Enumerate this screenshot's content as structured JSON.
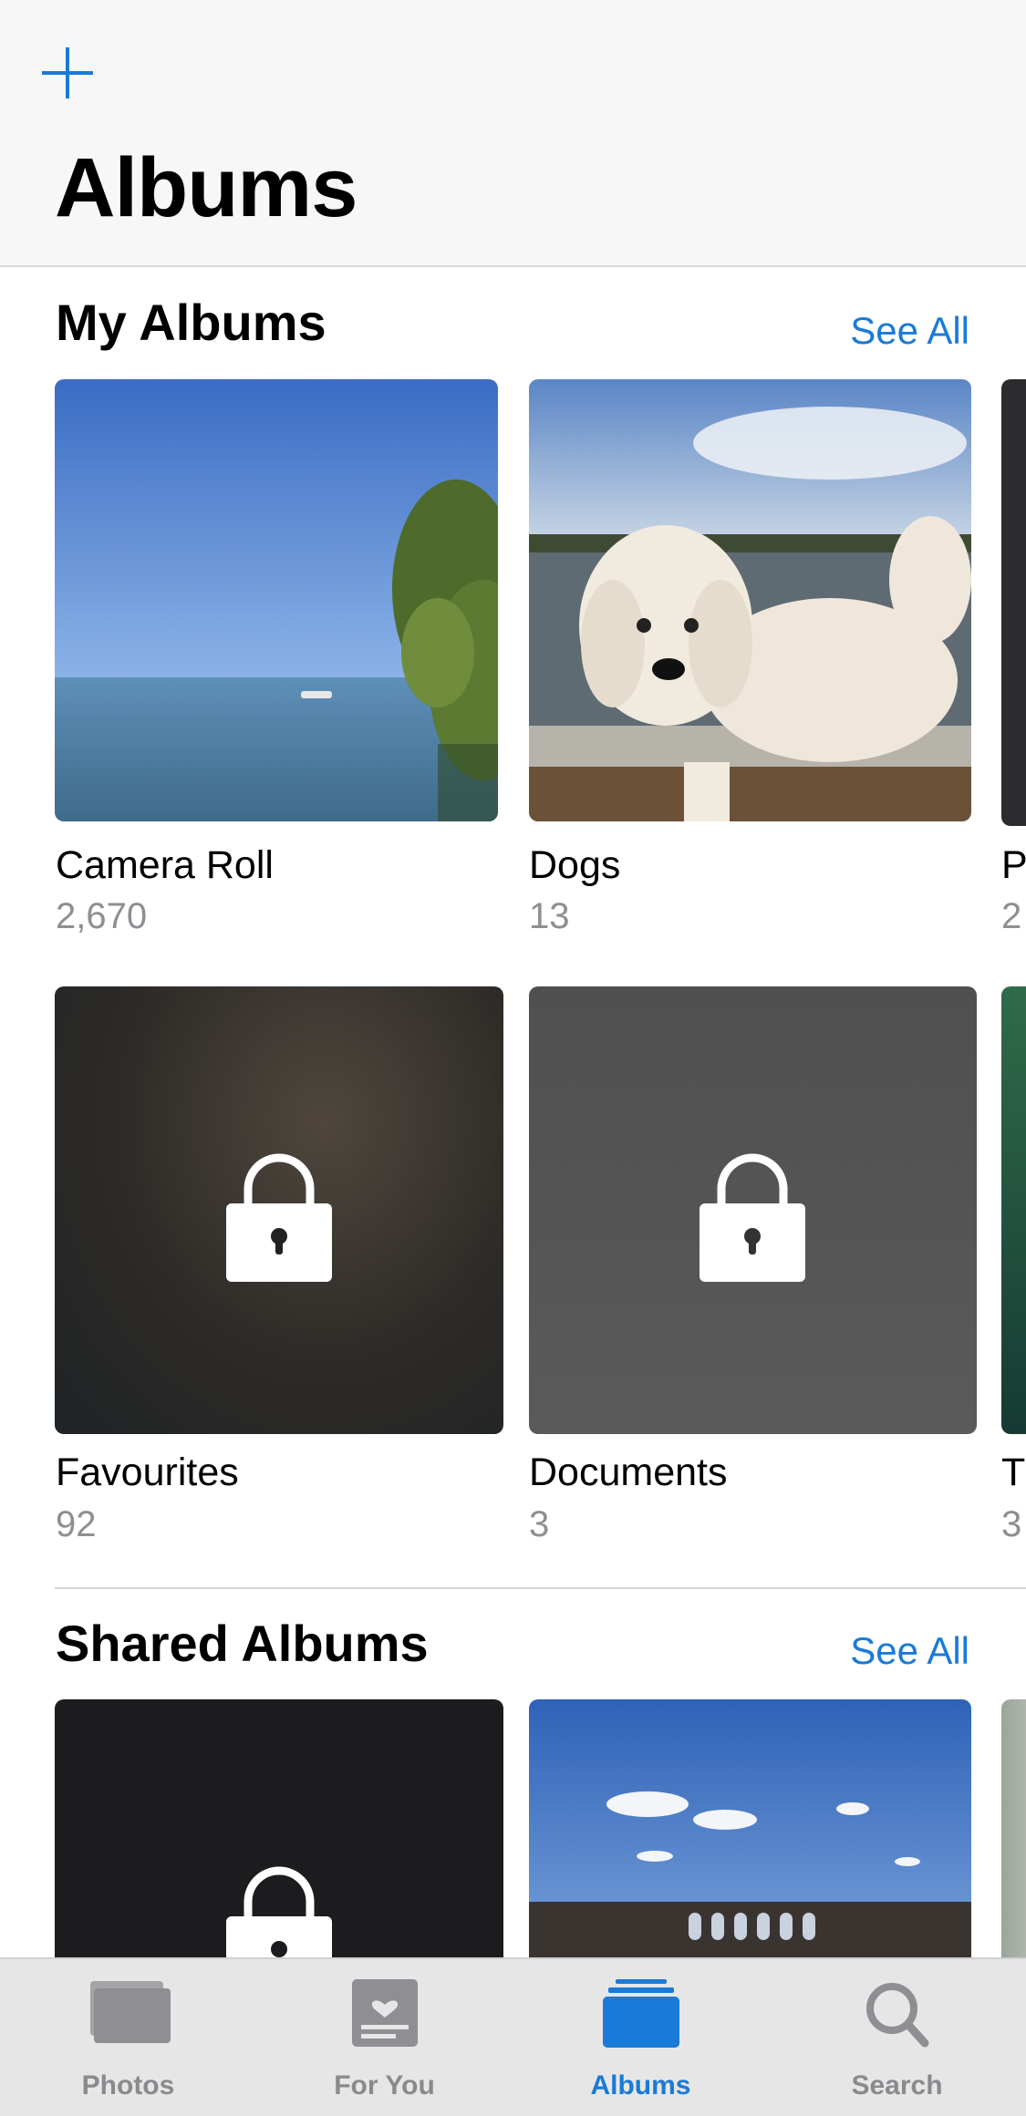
{
  "header": {
    "title": "Albums",
    "add_icon": "plus-icon"
  },
  "my_albums": {
    "title": "My Albums",
    "see_all": "See All",
    "albums": [
      {
        "name": "Camera Roll",
        "count": "2,670",
        "thumbnail": "seascape-tree",
        "locked": false
      },
      {
        "name": "Dogs",
        "count": "13",
        "thumbnail": "white-poodle",
        "locked": false
      },
      {
        "name": "P",
        "count": "2",
        "thumbnail": "dark",
        "locked": false
      },
      {
        "name": "Favourites",
        "count": "92",
        "thumbnail": "blurred-dark",
        "locked": true
      },
      {
        "name": "Documents",
        "count": "3",
        "thumbnail": "gray",
        "locked": true
      },
      {
        "name": "T",
        "count": "3",
        "thumbnail": "green",
        "locked": false
      }
    ]
  },
  "shared_albums": {
    "title": "Shared Albums",
    "see_all": "See All",
    "albums": [
      {
        "thumbnail": "black",
        "locked": true
      },
      {
        "thumbnail": "arcade-sky",
        "locked": false
      },
      {
        "thumbnail": "partial",
        "locked": false
      }
    ]
  },
  "tabbar": {
    "tabs": [
      {
        "label": "Photos",
        "icon": "photos-stack-icon",
        "active": false
      },
      {
        "label": "For You",
        "icon": "for-you-heart-icon",
        "active": false
      },
      {
        "label": "Albums",
        "icon": "albums-stack-icon",
        "active": true
      },
      {
        "label": "Search",
        "icon": "search-icon",
        "active": false
      }
    ]
  },
  "colors": {
    "accent": "#1a7ad8",
    "secondary_text": "#8e8e93",
    "tab_inactive": "#8a8a8e"
  }
}
